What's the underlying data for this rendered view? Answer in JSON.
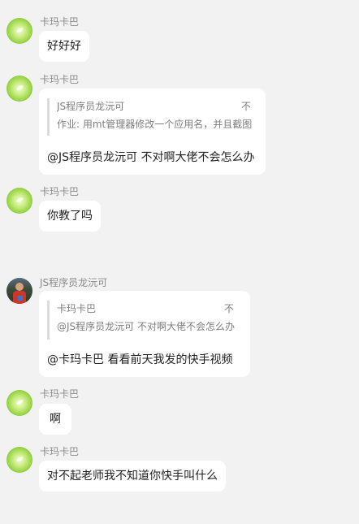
{
  "messages": [
    {
      "sender": "卡玛卡巴",
      "avatar": "green-leaf-avatar",
      "text": "好好好"
    },
    {
      "sender": "卡玛卡巴",
      "avatar": "green-leaf-avatar",
      "quote": {
        "author": "JS程序员龙沅可",
        "author_suffix": "不",
        "text": "作业: 用mt管理器修改一个应用名，并且截图"
      },
      "text": "@JS程序员龙沅可 不对啊大佬不会怎么办"
    },
    {
      "sender": "卡玛卡巴",
      "avatar": "green-leaf-avatar",
      "text": "你教了吗"
    },
    {
      "sender": "JS程序员龙沅可",
      "avatar": "photo-avatar",
      "quote": {
        "author": "卡玛卡巴",
        "author_suffix": "不",
        "text": "@JS程序员龙沅可 不对啊大佬不会怎么办"
      },
      "text": "@卡玛卡巴 看看前天我发的快手视频"
    },
    {
      "sender": "卡玛卡巴",
      "avatar": "green-leaf-avatar",
      "text": "啊"
    },
    {
      "sender": "卡玛卡巴",
      "avatar": "green-leaf-avatar",
      "text": "对不起老师我不知道你快手叫什么"
    }
  ]
}
